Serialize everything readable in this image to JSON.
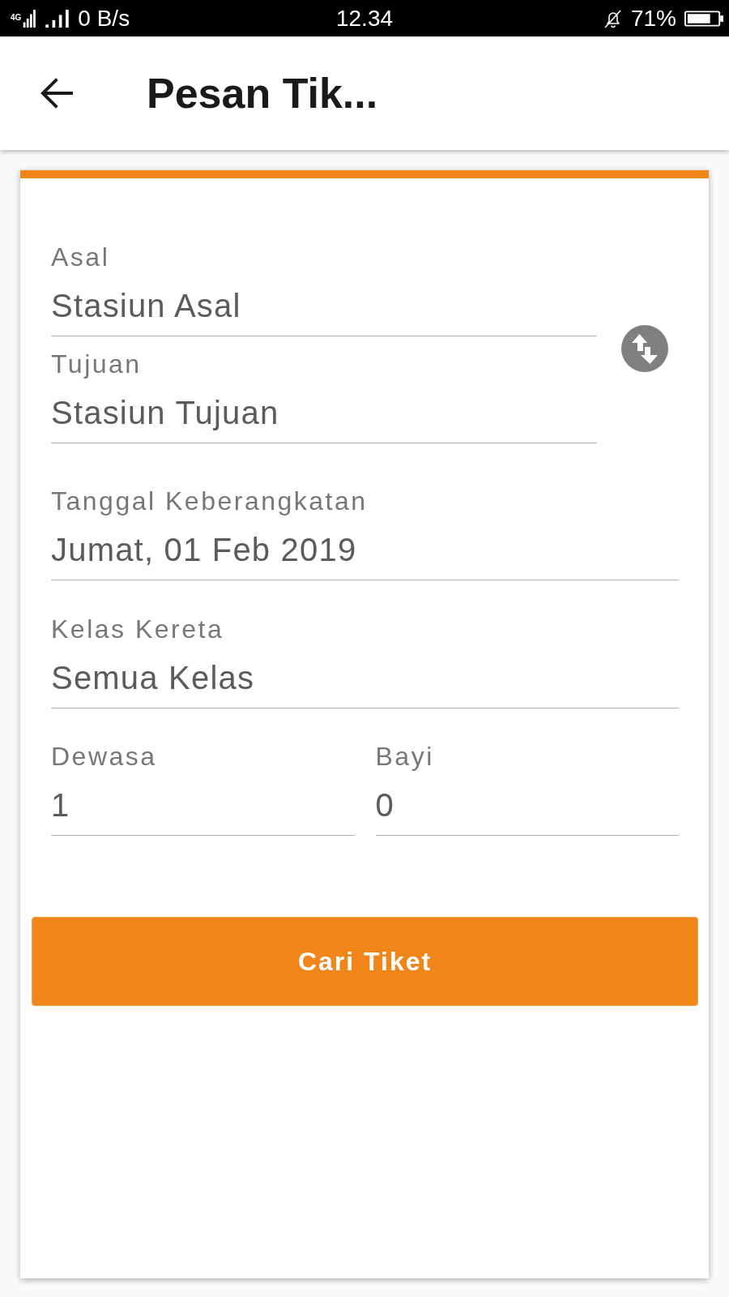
{
  "status_bar": {
    "network_type": "4G",
    "data_rate": "0 B/s",
    "time": "12.34",
    "battery_percent": "71%"
  },
  "app_bar": {
    "title": "Pesan Tik..."
  },
  "form": {
    "station_fields": [
      {
        "label": "Asal",
        "value": "Stasiun Asal"
      },
      {
        "label": "Tujuan",
        "value": "Stasiun Tujuan"
      }
    ],
    "fields": [
      {
        "label": "Tanggal Keberangkatan",
        "value": "Jumat, 01 Feb 2019"
      },
      {
        "label": "Kelas Kereta",
        "value": "Semua Kelas"
      }
    ],
    "passenger_fields": [
      {
        "label": "Dewasa",
        "value": "1"
      },
      {
        "label": "Bayi",
        "value": "0"
      }
    ],
    "search_button": {
      "label": "Cari Tiket"
    }
  }
}
